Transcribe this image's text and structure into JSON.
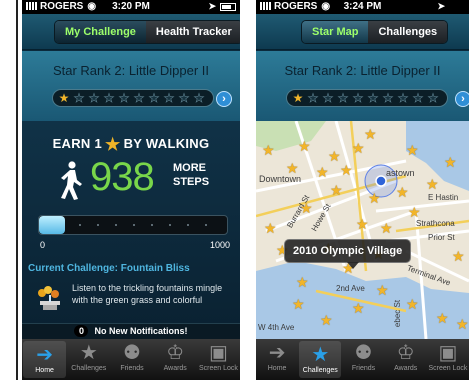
{
  "left_screen": {
    "status": {
      "carrier": "ROGERS",
      "time": "3:20 PM"
    },
    "tabs": [
      "My Challenge",
      "Health Tracker"
    ],
    "rank_title": "Star Rank 2: Little Dipper II",
    "rank_stars_earned": 1,
    "rank_stars_total": 10,
    "earn": {
      "prefix": "EARN 1",
      "suffix": "BY WALKING"
    },
    "steps": {
      "value": "938",
      "label_line1": "MORE",
      "label_line2": "STEPS"
    },
    "progress": {
      "min": "0",
      "max": "1000",
      "fraction": 0.062
    },
    "challenge_title": "Current Challenge: Fountain Bliss",
    "challenge_desc": "Listen to the trickling fountains mingle with the green grass and colorful",
    "notifications": {
      "count": "0",
      "text": "No New Notifications!"
    },
    "tabbar": [
      {
        "label": "Home",
        "icon": "walker-icon",
        "active": true
      },
      {
        "label": "Challenges",
        "icon": "star-icon",
        "active": false
      },
      {
        "label": "Friends",
        "icon": "friends-icon",
        "active": false
      },
      {
        "label": "Awards",
        "icon": "trophy-icon",
        "active": false
      },
      {
        "label": "Screen Lock",
        "icon": "lock-icon",
        "active": false
      }
    ]
  },
  "right_screen": {
    "status": {
      "carrier": "ROGERS",
      "time": "3:24 PM"
    },
    "tabs": [
      "Star Map",
      "Challenges"
    ],
    "rank_title": "Star Rank 2: Little Dipper II",
    "map_labels": {
      "downtown": "Downtown",
      "gastown": "astown",
      "hastings": "E Hastin",
      "strathcona": "Strathcona",
      "prior": "Prior St",
      "terminal": "Terminal Ave",
      "second": "2nd Ave",
      "burrard": "Burrard St",
      "howe": "Howe St",
      "granville": "W 4th Ave",
      "quebec": "ebec St"
    },
    "callout": "2010 Olympic Village",
    "tabbar": [
      {
        "label": "Home",
        "icon": "walker-icon",
        "active": false
      },
      {
        "label": "Challenges",
        "icon": "star-icon",
        "active": true
      },
      {
        "label": "Friends",
        "icon": "friends-icon",
        "active": false
      },
      {
        "label": "Awards",
        "icon": "trophy-icon",
        "active": false
      },
      {
        "label": "Screen Lock",
        "icon": "lock-icon",
        "active": false
      }
    ]
  },
  "colors": {
    "accent_green": "#79d64a",
    "accent_blue": "#2aa0e8",
    "star_gold": "#f0b428"
  }
}
